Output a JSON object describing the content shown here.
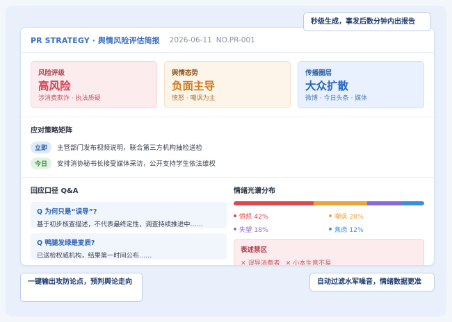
{
  "header": {
    "brand": "PR STRATEGY · 舆情风险评估简报",
    "date": "2026-06-11",
    "number": "NO.PR-001"
  },
  "metrics": [
    {
      "label": "风险评级",
      "value": "高风险",
      "sub": "涉消费欺诈 · 执法质疑"
    },
    {
      "label": "舆情态势",
      "value": "负面主导",
      "sub": "愤怒 · 嘲讽为主"
    },
    {
      "label": "传播圈层",
      "value": "大众扩散",
      "sub": "微博 · 今日头条 · 媒体"
    }
  ],
  "strategy": {
    "title": "应对策略矩阵",
    "rows": [
      {
        "tag": "立即",
        "text": "主管部门发布视频说明，联合第三方机构抽检送检"
      },
      {
        "tag": "今日",
        "text": "安排消协秘书长接受媒体采访，公开支持学生依法维权"
      }
    ]
  },
  "qa": {
    "title": "回应口径 Q&A",
    "items": [
      {
        "q": "Q 为何只是“误导”?",
        "a": "基于初步核查描述，不代表最终定性，调查持续推进中……"
      },
      {
        "q": "Q 鸭腿发绿是变质?",
        "a": "已送检权威机构，结果第一时间公布……"
      }
    ]
  },
  "emotion": {
    "title": "情绪光谱分布",
    "items": [
      {
        "label": "愤怒 42%",
        "pct": 42,
        "color": "#e0474c"
      },
      {
        "label": "嘲讽 28%",
        "pct": 28,
        "color": "#eea23a"
      },
      {
        "label": "失望 18%",
        "pct": 18,
        "color": "#8a6ad6"
      },
      {
        "label": "焦虑 12%",
        "pct": 12,
        "color": "#3a8ee0"
      }
    ]
  },
  "ban": {
    "title": "表述禁区",
    "items": [
      "✕ 误导消费者",
      "✕ 小本生意不易"
    ]
  },
  "callouts": {
    "top": "秒级生成，事发后数分钟内出报告",
    "left": "一键输出攻防论点，预判舆论走向",
    "right": "自动过滤水军噪音，情绪数据更准"
  }
}
